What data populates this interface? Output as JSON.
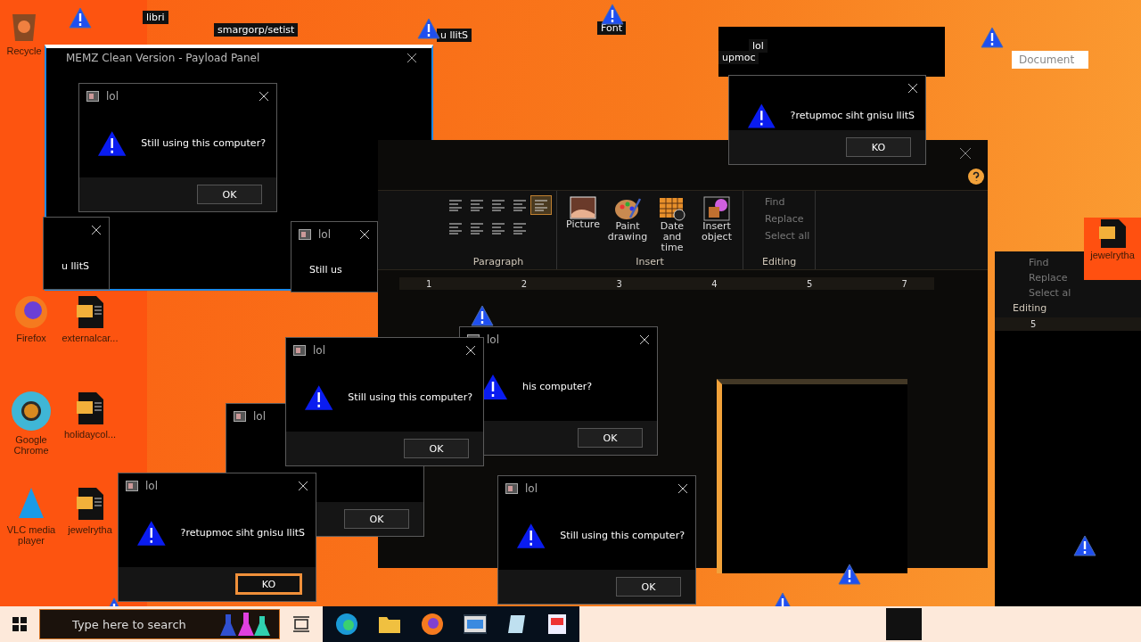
{
  "desktop_icons": [
    {
      "label": "Recycle",
      "kind": "bin"
    },
    {
      "label": "Firefox",
      "kind": "firefox"
    },
    {
      "label": "externalcar...",
      "kind": "doc"
    },
    {
      "label": "Google Chrome",
      "kind": "chrome"
    },
    {
      "label": "holidaycol...",
      "kind": "doc"
    },
    {
      "label": "VLC media player",
      "kind": "vlc"
    },
    {
      "label": "jewelrytha",
      "kind": "doc"
    }
  ],
  "top_labels": [
    "libri",
    "smargorp/setist",
    "u llitS",
    "Font",
    "upmoc",
    "lol"
  ],
  "payload_panel": {
    "title": "MEMZ Clean Version - Payload Panel"
  },
  "wordpad": {
    "paragraph_label": "Paragraph",
    "insert_label": "Insert",
    "insert_items": [
      {
        "label": "Picture",
        "kind": "picture"
      },
      {
        "label": "Paint drawing",
        "kind": "paint"
      },
      {
        "label": "Date and time",
        "kind": "calendar"
      },
      {
        "label": "Insert object",
        "kind": "object"
      }
    ],
    "editing_label": "Editing",
    "editing_items": [
      "Find",
      "Replace",
      "Select all"
    ],
    "ruler": [
      "1",
      "2",
      "3",
      "4",
      "5",
      "7"
    ]
  },
  "wordpad_copy": {
    "editing_label": "Editing",
    "editing_items": [
      "Find",
      "Replace",
      "Select al"
    ],
    "ruler": [
      "5"
    ]
  },
  "document_tab": "Document",
  "right_icon": "jewelrytha",
  "dialogs": [
    {
      "title": "lol",
      "message": "Still us"
    },
    {
      "title": "lol",
      "button": "OK",
      "focused": false
    },
    {
      "title": "lol",
      "message": "his computer?",
      "button": "OK",
      "focused": false
    },
    {
      "title": "lol",
      "message": "Still using this computer?",
      "button": "OK",
      "focused": false
    },
    {
      "message": "u llitS"
    },
    {
      "title": "lol",
      "message": "Still using this computer?",
      "button": "OK",
      "focused": false
    },
    {
      "message": "?retupmoc siht gnisu llitS",
      "button": "KO",
      "focused": false
    },
    {
      "title": "lol",
      "message": "?retupmoc siht gnisu llitS",
      "button": "KO",
      "focused": true
    },
    {
      "title": "lol",
      "message": "Still using this computer?",
      "button": "OK",
      "focused": false
    }
  ],
  "taskbar": {
    "search_placeholder": "Type here to search"
  }
}
